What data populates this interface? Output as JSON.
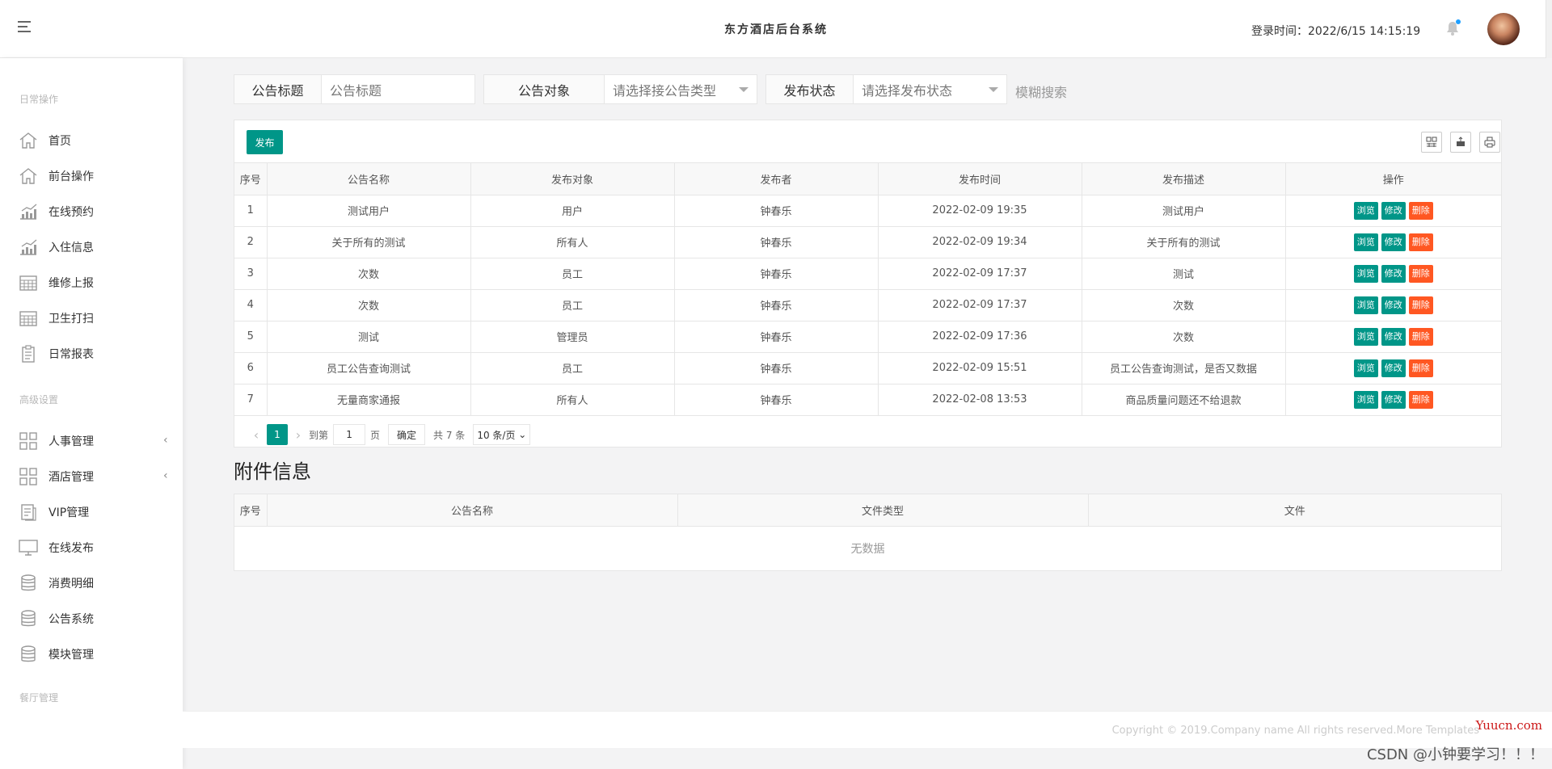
{
  "header": {
    "title": "东方酒店后台系统",
    "login_time": "登录时间：2022/6/15 14:15:19"
  },
  "sidebar": {
    "section_daily": "日常操作",
    "section_advanced": "高级设置",
    "section_dining": "餐厅管理",
    "daily_items": [
      {
        "label": "首页",
        "icon": "home-icon"
      },
      {
        "label": "前台操作",
        "icon": "home-icon"
      },
      {
        "label": "在线预约",
        "icon": "chart-icon"
      },
      {
        "label": "入住信息",
        "icon": "chart-icon"
      },
      {
        "label": "维修上报",
        "icon": "calendar-icon"
      },
      {
        "label": "卫生打扫",
        "icon": "calendar-icon"
      },
      {
        "label": "日常报表",
        "icon": "clipboard-icon"
      }
    ],
    "advanced_items": [
      {
        "label": "人事管理",
        "icon": "grid-icon",
        "expandable": true
      },
      {
        "label": "酒店管理",
        "icon": "grid-icon",
        "expandable": true
      },
      {
        "label": "VIP管理",
        "icon": "document-icon"
      },
      {
        "label": "在线发布",
        "icon": "monitor-icon"
      },
      {
        "label": "消费明细",
        "icon": "database-icon"
      },
      {
        "label": "公告系统",
        "icon": "database-icon"
      },
      {
        "label": "模块管理",
        "icon": "database-icon"
      }
    ]
  },
  "filters": {
    "title_label": "公告标题",
    "title_placeholder": "公告标题",
    "target_label": "公告对象",
    "target_placeholder": "请选择接公告类型",
    "status_label": "发布状态",
    "status_placeholder": "请选择发布状态",
    "fuzzy_search": "模糊搜索"
  },
  "toolbar": {
    "publish_label": "发布"
  },
  "table": {
    "columns": [
      "序号",
      "公告名称",
      "发布对象",
      "发布者",
      "发布时间",
      "发布描述",
      "操作"
    ],
    "rows": [
      [
        "1",
        "测试用户",
        "用户",
        "钟春乐",
        "2022-02-09 19:35",
        "测试用户"
      ],
      [
        "2",
        "关于所有的测试",
        "所有人",
        "钟春乐",
        "2022-02-09 19:34",
        "关于所有的测试"
      ],
      [
        "3",
        "次数",
        "员工",
        "钟春乐",
        "2022-02-09 17:37",
        "测试"
      ],
      [
        "4",
        "次数",
        "员工",
        "钟春乐",
        "2022-02-09 17:37",
        "次数"
      ],
      [
        "5",
        "测试",
        "管理员",
        "钟春乐",
        "2022-02-09 17:36",
        "次数"
      ],
      [
        "6",
        "员工公告查询测试",
        "员工",
        "钟春乐",
        "2022-02-09 15:51",
        "员工公告查询测试，是否又数据"
      ],
      [
        "7",
        "无量商家通报",
        "所有人",
        "钟春乐",
        "2022-02-08 13:53",
        "商品质量问题还不给退款"
      ]
    ],
    "action_view": "浏览",
    "action_edit": "修改",
    "action_delete": "删除"
  },
  "pager": {
    "current_page": "1",
    "goto_label": "到第",
    "goto_value": "1",
    "page_unit": "页",
    "confirm_label": "确定",
    "total_label": "共 7 条",
    "page_size": "10 条/页"
  },
  "attachments": {
    "title": "附件信息",
    "columns": [
      "序号",
      "公告名称",
      "文件类型",
      "文件"
    ],
    "empty_text": "无数据"
  },
  "footer": {
    "copyright": "Copyright © 2019.Company name All rights reserved.More Templates",
    "watermark_site": "Yuucn.com",
    "watermark_author": "CSDN @小钟要学习！！！"
  }
}
